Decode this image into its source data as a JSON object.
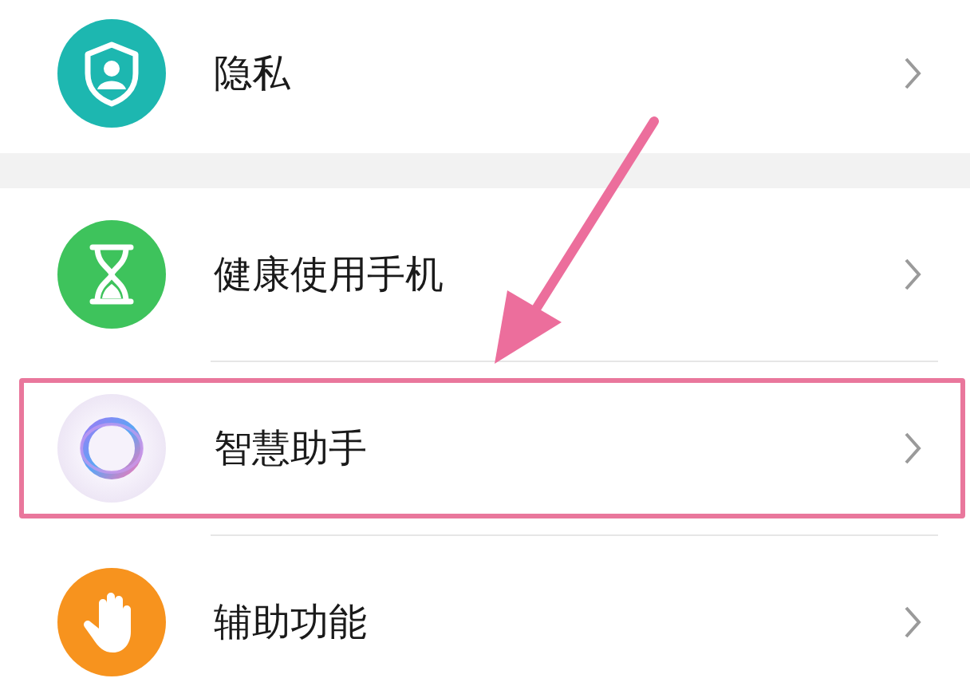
{
  "groups": [
    {
      "items": [
        {
          "label": "隐私",
          "kind": "shield",
          "highlighted": false
        }
      ]
    },
    {
      "items": [
        {
          "label": "健康使用手机",
          "kind": "hourglass",
          "highlighted": false
        },
        {
          "label": "智慧助手",
          "kind": "ring",
          "highlighted": true
        },
        {
          "label": "辅助功能",
          "kind": "hand",
          "highlighted": false
        }
      ]
    }
  ]
}
